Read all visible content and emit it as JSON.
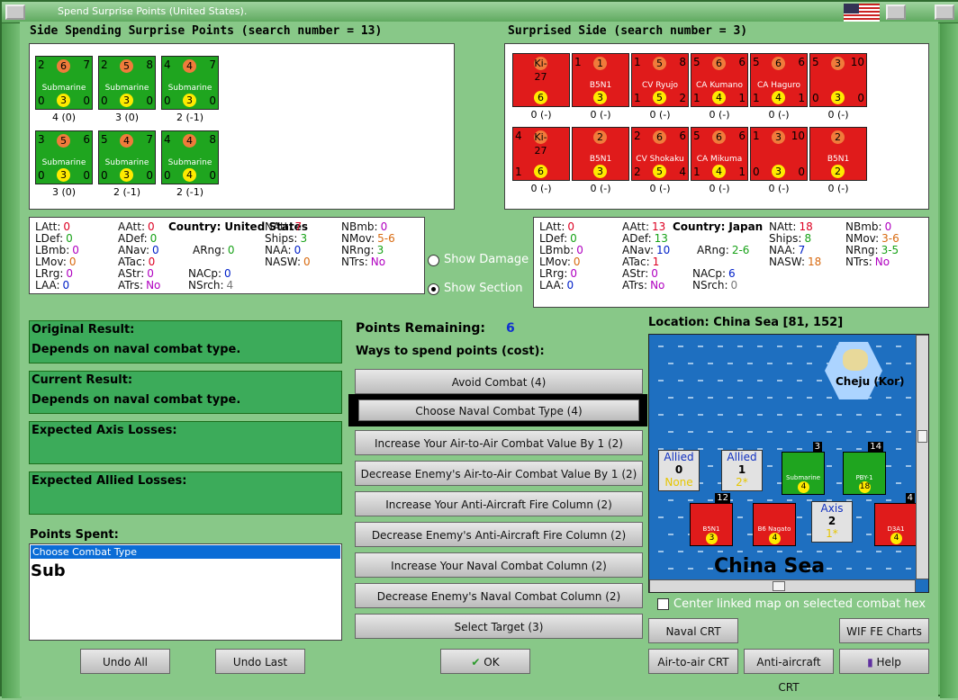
{
  "window": {
    "title": "Spend Surprise Points (United States)."
  },
  "spending": {
    "heading": "Side Spending Surprise Points (search number = 13)",
    "counters": [
      {
        "tl": "2",
        "tc": "6",
        "tr": "7",
        "type": "Submarine",
        "bl": "0",
        "bc": "3",
        "br": "0",
        "label": "4 (0)"
      },
      {
        "tl": "2",
        "tc": "5",
        "tr": "8",
        "type": "Submarine",
        "bl": "0",
        "bc": "3",
        "br": "0",
        "label": "3 (0)"
      },
      {
        "tl": "4",
        "tc": "4",
        "tr": "7",
        "type": "Submarine",
        "bl": "0",
        "bc": "3",
        "br": "0",
        "label": "2 (-1)"
      },
      {
        "tl": "3",
        "tc": "5",
        "tr": "6",
        "type": "Submarine",
        "bl": "0",
        "bc": "3",
        "br": "0",
        "label": "3 (0)"
      },
      {
        "tl": "5",
        "tc": "4",
        "tr": "7",
        "type": "Submarine",
        "bl": "0",
        "bc": "3",
        "br": "0",
        "label": "2 (-1)"
      },
      {
        "tl": "4",
        "tc": "4",
        "tr": "8",
        "type": "Submarine",
        "bl": "0",
        "bc": "4",
        "br": "0",
        "label": "2 (-1)"
      }
    ]
  },
  "surprised": {
    "heading": "Surprised Side (search number = 3)",
    "counters": [
      {
        "tl": "",
        "tc": "Ki-27",
        "tr": "",
        "type": "",
        "bl": "",
        "bc": "6",
        "br": "",
        "label": "0 (-)"
      },
      {
        "tl": "1",
        "tc": "1",
        "tr": "",
        "type": "B5N1",
        "bl": "",
        "bc": "3",
        "br": "",
        "label": "0 (-)"
      },
      {
        "tl": "1",
        "tc": "5",
        "tr": "8",
        "type": "CV Ryujo",
        "bl": "1",
        "bc": "5",
        "br": "2",
        "label": "0 (-)"
      },
      {
        "tl": "5",
        "tc": "6",
        "tr": "6",
        "type": "CA Kumano",
        "bl": "1",
        "bc": "4",
        "br": "1",
        "label": "0 (-)"
      },
      {
        "tl": "5",
        "tc": "6",
        "tr": "6",
        "type": "CA Haguro",
        "bl": "1",
        "bc": "4",
        "br": "1",
        "label": "0 (-)"
      },
      {
        "tl": "5",
        "tc": "3",
        "tr": "10",
        "type": "",
        "bl": "0",
        "bc": "3",
        "br": "0",
        "label": "0 (-)"
      },
      {
        "tl": "4",
        "tc": "Ki-27",
        "tr": "",
        "type": "",
        "bl": "1",
        "bc": "6",
        "br": "",
        "label": "0 (-)"
      },
      {
        "tl": "",
        "tc": "2",
        "tr": "",
        "type": "B5N1",
        "bl": "",
        "bc": "3",
        "br": "",
        "label": "0 (-)"
      },
      {
        "tl": "2",
        "tc": "6",
        "tr": "6",
        "type": "CV Shokaku",
        "bl": "2",
        "bc": "5",
        "br": "4",
        "label": "0 (-)"
      },
      {
        "tl": "5",
        "tc": "6",
        "tr": "6",
        "type": "CA Mikuma",
        "bl": "1",
        "bc": "4",
        "br": "1",
        "label": "0 (-)"
      },
      {
        "tl": "1",
        "tc": "3",
        "tr": "10",
        "type": "",
        "bl": "0",
        "bc": "3",
        "br": "0",
        "label": "0 (-)"
      },
      {
        "tl": "",
        "tc": "2",
        "tr": "",
        "type": "B5N1",
        "bl": "",
        "bc": "2",
        "br": "",
        "label": "0 (-)"
      }
    ]
  },
  "stats_us": {
    "country_label": "Country:",
    "country": "United States",
    "rows": [
      [
        "LAtt:",
        "0",
        "AAtt:",
        "0",
        "NAtt:",
        "7",
        "NBmb:",
        "0"
      ],
      [
        "LDef:",
        "0",
        "ADef:",
        "0",
        "Ships:",
        "3",
        "NMov:",
        "5-6"
      ],
      [
        "LBmb:",
        "0",
        "ANav:",
        "0",
        "ARng:",
        "0",
        "NAA:",
        "0",
        "NRng:",
        "3"
      ],
      [
        "LMov:",
        "0",
        "ATac:",
        "0",
        "NASW:",
        "0",
        "NTrs:",
        "No"
      ],
      [
        "LRrg:",
        "0",
        "AStr:",
        "0",
        "NACp:",
        "0"
      ],
      [
        "LAA:",
        "0",
        "ATrs:",
        "No",
        "NSrch:",
        "4"
      ]
    ]
  },
  "stats_jp": {
    "country_label": "Country:",
    "country": "Japan",
    "rows": [
      [
        "LAtt:",
        "0",
        "AAtt:",
        "13",
        "NAtt:",
        "18",
        "NBmb:",
        "0"
      ],
      [
        "LDef:",
        "0",
        "ADef:",
        "13",
        "Ships:",
        "8",
        "NMov:",
        "3-6"
      ],
      [
        "LBmb:",
        "0",
        "ANav:",
        "10",
        "ARng:",
        "2-6",
        "NAA:",
        "7",
        "NRng:",
        "3-5"
      ],
      [
        "LMov:",
        "0",
        "ATac:",
        "1",
        "NASW:",
        "18",
        "NTrs:",
        "No"
      ],
      [
        "LRrg:",
        "0",
        "AStr:",
        "0",
        "NACp:",
        "6"
      ],
      [
        "LAA:",
        "0",
        "ATrs:",
        "No",
        "NSrch:",
        "0"
      ]
    ]
  },
  "options": {
    "show_damage": "Show Damage",
    "show_section": "Show Section"
  },
  "results": [
    {
      "title": "Original Result:",
      "text": "Depends on naval combat type."
    },
    {
      "title": "Current Result:",
      "text": "Depends on naval combat type."
    },
    {
      "title": "Expected Axis Losses:",
      "text": ""
    },
    {
      "title": "Expected Allied Losses:",
      "text": ""
    }
  ],
  "points_spent": {
    "label": "Points Spent:",
    "selected": "Choose Combat Type",
    "big": "Sub"
  },
  "points": {
    "label": "Points Remaining:",
    "value": "6",
    "ways": "Ways to spend points (cost):"
  },
  "ways": [
    "Avoid Combat (4)",
    "Choose Naval Combat Type (4)",
    "Increase Your Air-to-Air Combat Value By 1 (2)",
    "Decrease Enemy's Air-to-Air Combat Value By 1 (2)",
    "Increase Your Anti-Aircraft Fire Column (2)",
    "Decrease Enemy's Anti-Aircraft Fire Column (2)",
    "Increase Your Naval Combat Column (2)",
    "Decrease Enemy's Naval Combat Column (2)",
    "Select Target (3)"
  ],
  "location": {
    "label": "Location: China Sea [81, 152]",
    "island": "Cheju (Kor)",
    "sea": "China Sea"
  },
  "map_info": [
    {
      "title": "Allied",
      "value": "0",
      "sub": "None"
    },
    {
      "title": "Allied",
      "value": "1",
      "sub": "2*"
    },
    {
      "title": "Axis",
      "value": "2",
      "sub": "1*"
    }
  ],
  "map_counters": {
    "top": [
      {
        "badge": "3",
        "type": "Submarine",
        "n": "4"
      },
      {
        "badge": "14",
        "type": "PBY-1",
        "n": "18"
      }
    ],
    "bottom": [
      {
        "badge": "12",
        "type": "B5N1",
        "n": "3"
      },
      {
        "badge": "",
        "type": "B6 Nagato",
        "n": "4"
      },
      {
        "badge": "4",
        "type": "D3A1",
        "n": "4"
      }
    ]
  },
  "center_map": "Center linked map on selected combat hex",
  "buttons": {
    "undo_all": "Undo All",
    "undo_last": "Undo Last",
    "ok": "OK",
    "naval_crt": "Naval CRT",
    "wif_charts": "WIF FE Charts",
    "air_crt": "Air-to-air CRT",
    "aa_crt": "Anti-aircraft CRT",
    "help": "Help"
  }
}
